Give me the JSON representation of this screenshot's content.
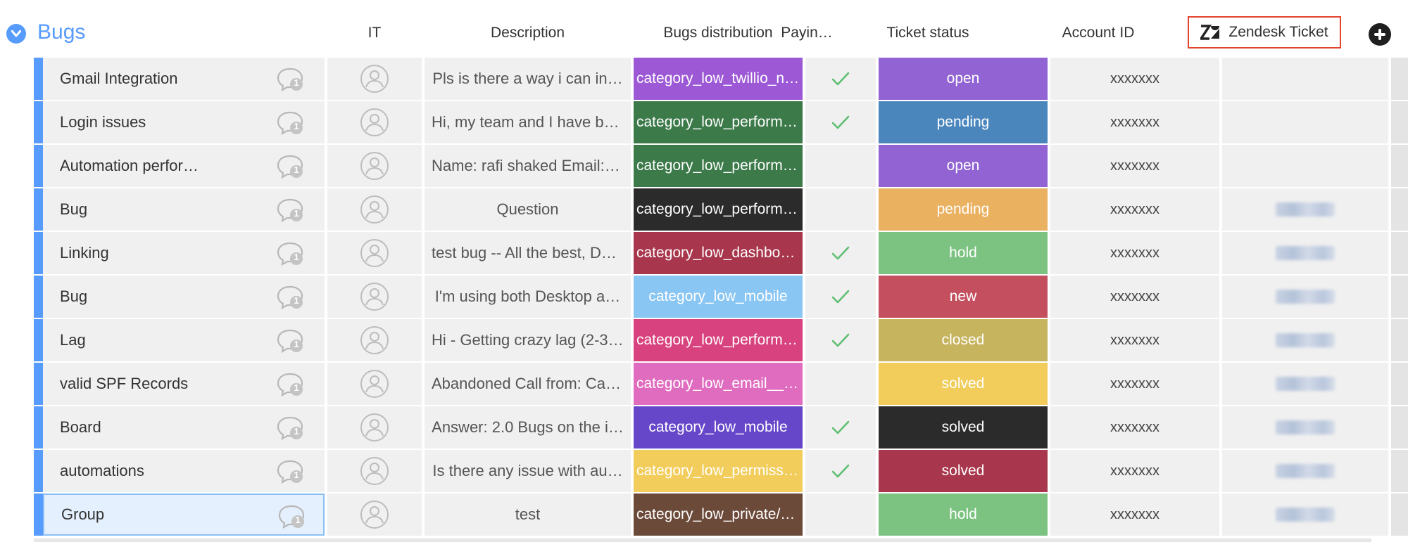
{
  "group": {
    "title": "Bugs",
    "color": "#579bfc"
  },
  "columns": {
    "it": "IT",
    "description": "Description",
    "bugs_distribution": "Bugs distribution",
    "paying": "Payin…",
    "ticket_status": "Ticket status",
    "account_id": "Account ID",
    "zendesk_ticket": "Zendesk Ticket"
  },
  "icons": {
    "group_toggle": "chevron-down-icon",
    "updates": "speech-bubble-icon",
    "person": "person-avatar-icon",
    "check": "checkmark-icon",
    "zendesk": "zendesk-logo-icon",
    "add_column": "plus-circle-icon"
  },
  "rows": [
    {
      "name": "Gmail Integration",
      "updates": "1",
      "description": "Pls is there a way i can in…",
      "distribution": "category_low_twillio_no…",
      "distribution_color": "#9d58d6",
      "paying": true,
      "status": "open",
      "status_color": "#9163d3",
      "account_id": "xxxxxxx",
      "zendesk_blurred": false
    },
    {
      "name": "Login issues",
      "updates": "1",
      "description": "Hi, my team and I have be…",
      "distribution": "category_low_performa…",
      "distribution_color": "#3c7a4a",
      "paying": true,
      "status": "pending",
      "status_color": "#4a86bc",
      "account_id": "xxxxxxx",
      "zendesk_blurred": false
    },
    {
      "name": "Automation perfor…",
      "updates": "1",
      "description": "Name: rafi shaked Email: …",
      "distribution": "category_low_performa…",
      "distribution_color": "#3c7a4a",
      "paying": false,
      "status": "open",
      "status_color": "#9163d3",
      "account_id": "xxxxxxx",
      "zendesk_blurred": false
    },
    {
      "name": "Bug",
      "updates": "1",
      "description": "Question",
      "distribution": "category_low_performa…",
      "distribution_color": "#2b2b2b",
      "paying": false,
      "status": "pending",
      "status_color": "#e9b160",
      "account_id": "xxxxxxx",
      "zendesk_blurred": true
    },
    {
      "name": "Linking",
      "updates": "1",
      "description": "test bug -- All the best, Do…",
      "distribution": "category_low_dashboar…",
      "distribution_color": "#a8364c",
      "paying": true,
      "status": "hold",
      "status_color": "#7cc382",
      "account_id": "xxxxxxx",
      "zendesk_blurred": true
    },
    {
      "name": "Bug",
      "updates": "1",
      "description": "I'm using both Desktop a…",
      "distribution": "category_low_mobile",
      "distribution_color": "#8ac6f3",
      "paying": true,
      "status": "new",
      "status_color": "#c4505f",
      "account_id": "xxxxxxx",
      "zendesk_blurred": true
    },
    {
      "name": "Lag",
      "updates": "1",
      "description": "Hi - Getting crazy lag (2-3 …",
      "distribution": "category_low_performa…",
      "distribution_color": "#d8427e",
      "paying": true,
      "status": "closed",
      "status_color": "#c7b45e",
      "account_id": "xxxxxxx",
      "zendesk_blurred": true
    },
    {
      "name": "valid SPF Records",
      "updates": "1",
      "description": "Abandoned Call from: Cal…",
      "distribution": "category_low_email__ot…",
      "distribution_color": "#e06cbf",
      "paying": false,
      "status": "solved",
      "status_color": "#f2cd5c",
      "account_id": "xxxxxxx",
      "zendesk_blurred": true
    },
    {
      "name": "Board",
      "updates": "1",
      "description": "Answer: 2.0 Bugs on the i…",
      "distribution": "category_low_mobile",
      "distribution_color": "#6747c9",
      "paying": true,
      "status": "solved",
      "status_color": "#2b2b2b",
      "account_id": "xxxxxxx",
      "zendesk_blurred": true
    },
    {
      "name": "automations",
      "updates": "1",
      "description": "Is there any issue with au…",
      "distribution": "category_low_permissi…",
      "distribution_color": "#f2cd5c",
      "paying": true,
      "status": "solved",
      "status_color": "#a8364c",
      "account_id": "xxxxxxx",
      "zendesk_blurred": true
    },
    {
      "name": "Group",
      "updates": "1",
      "description": "test",
      "distribution": "category_low_private/s…",
      "distribution_color": "#6c4a3a",
      "paying": false,
      "status": "hold",
      "status_color": "#7cc382",
      "account_id": "xxxxxxx",
      "zendesk_blurred": true,
      "selected": true
    }
  ]
}
